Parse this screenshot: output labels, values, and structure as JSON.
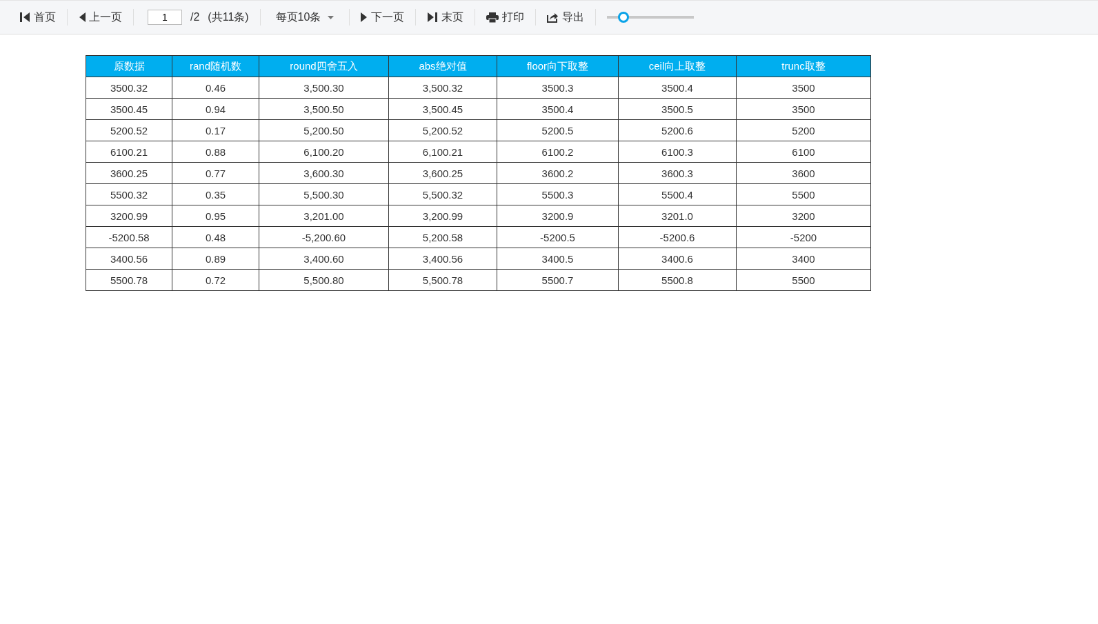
{
  "toolbar": {
    "first": "首页",
    "prev": "上一页",
    "page_input": "1",
    "page_total": "/2",
    "record_count": "(共11条)",
    "page_size": "每页10条",
    "next": "下一页",
    "last": "末页",
    "print": "打印",
    "export": "导出",
    "zoom_slider": {
      "level": 0.14
    }
  },
  "table": {
    "columns": [
      "原数据",
      "rand随机数",
      "round四舍五入",
      "abs绝对值",
      "floor向下取整",
      "ceil向上取整",
      "trunc取整"
    ],
    "rows": [
      [
        "3500.32",
        "0.46",
        "3,500.30",
        "3,500.32",
        "3500.3",
        "3500.4",
        "3500"
      ],
      [
        "3500.45",
        "0.94",
        "3,500.50",
        "3,500.45",
        "3500.4",
        "3500.5",
        "3500"
      ],
      [
        "5200.52",
        "0.17",
        "5,200.50",
        "5,200.52",
        "5200.5",
        "5200.6",
        "5200"
      ],
      [
        "6100.21",
        "0.88",
        "6,100.20",
        "6,100.21",
        "6100.2",
        "6100.3",
        "6100"
      ],
      [
        "3600.25",
        "0.77",
        "3,600.30",
        "3,600.25",
        "3600.2",
        "3600.3",
        "3600"
      ],
      [
        "5500.32",
        "0.35",
        "5,500.30",
        "5,500.32",
        "5500.3",
        "5500.4",
        "5500"
      ],
      [
        "3200.99",
        "0.95",
        "3,201.00",
        "3,200.99",
        "3200.9",
        "3201.0",
        "3200"
      ],
      [
        "-5200.58",
        "0.48",
        "-5,200.60",
        "5,200.58",
        "-5200.5",
        "-5200.6",
        "-5200"
      ],
      [
        "3400.56",
        "0.89",
        "3,400.60",
        "3,400.56",
        "3400.5",
        "3400.6",
        "3400"
      ],
      [
        "5500.78",
        "0.72",
        "5,500.80",
        "5,500.78",
        "5500.7",
        "5500.8",
        "5500"
      ]
    ]
  }
}
